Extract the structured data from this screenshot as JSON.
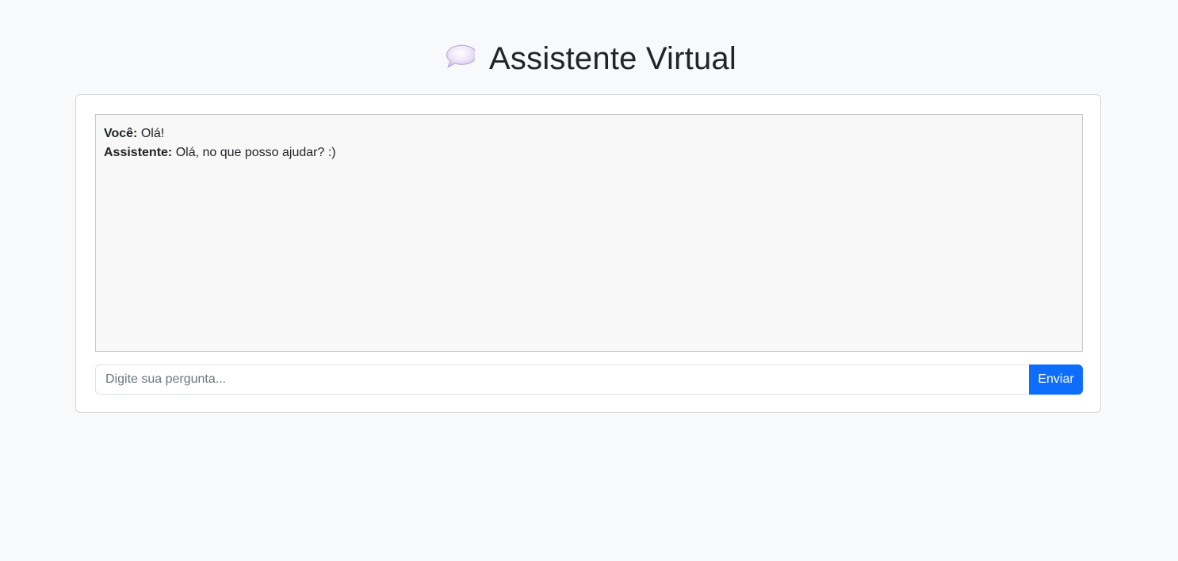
{
  "header": {
    "icon": "speech-balloon-icon",
    "title": "Assistente Virtual"
  },
  "chat": {
    "messages": [
      {
        "sender": "Você:",
        "text": "Olá!"
      },
      {
        "sender": "Assistente:",
        "text": "Olá, no que posso ajudar? :)"
      }
    ]
  },
  "composer": {
    "input_value": "",
    "input_placeholder": "Digite sua pergunta...",
    "send_label": "Enviar"
  },
  "colors": {
    "accent": "#0d6efd",
    "background": "#f8f9fa"
  }
}
